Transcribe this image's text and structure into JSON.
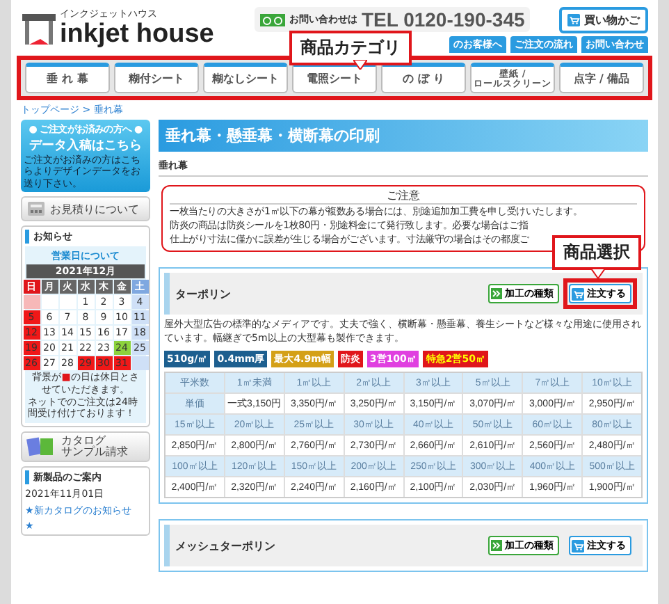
{
  "header": {
    "logo_kana": "インクジェットハウス",
    "logo_text": "inkjet house",
    "contact_label": "お問い合わせは",
    "phone": "TEL 0120-190-345",
    "cart_button": "買い物かご",
    "links": [
      "のお客様へ",
      "ご注文の流れ",
      "お問い合わせ"
    ]
  },
  "nav": {
    "items": [
      "垂 れ 幕",
      "糊付シート",
      "糊なしシート",
      "電照シート",
      "の ぼ り",
      "壁紙 /\nロールスクリーン",
      "点字 / 備品"
    ]
  },
  "annotations": {
    "category": "商品カテゴリ",
    "product_select": "商品選択"
  },
  "breadcrumb": "トップページ > 垂れ幕",
  "sidebar": {
    "data_banner": {
      "top": "● ご注文がお済みの方へ ●",
      "title": "データ入稿はこちら",
      "text": "ご注文がお済みの方はこちらよりデザインデータをお送り下さい。"
    },
    "estimate": "お見積りについて",
    "news": {
      "title": "お知らせ",
      "calendar": {
        "heading": "営業日について",
        "month": "2021年12月",
        "weekdays": [
          {
            "label": "日",
            "kind": "sun"
          },
          {
            "label": "月",
            "kind": "day"
          },
          {
            "label": "火",
            "kind": "day"
          },
          {
            "label": "水",
            "kind": "day"
          },
          {
            "label": "木",
            "kind": "day"
          },
          {
            "label": "金",
            "kind": "day"
          },
          {
            "label": "土",
            "kind": "sat"
          }
        ],
        "weeks": [
          [
            {
              "kind": "past"
            },
            {
              "kind": "normal"
            },
            {
              "kind": "normal"
            },
            {
              "day": "1",
              "kind": "normal"
            },
            {
              "day": "2",
              "kind": "normal"
            },
            {
              "day": "3",
              "kind": "normal"
            },
            {
              "day": "4",
              "kind": "sat"
            }
          ],
          [
            {
              "day": "5",
              "kind": "holiday"
            },
            {
              "day": "6",
              "kind": "normal"
            },
            {
              "day": "7",
              "kind": "normal"
            },
            {
              "day": "8",
              "kind": "normal"
            },
            {
              "day": "9",
              "kind": "normal"
            },
            {
              "day": "10",
              "kind": "normal"
            },
            {
              "day": "11",
              "kind": "sat"
            }
          ],
          [
            {
              "day": "12",
              "kind": "holiday"
            },
            {
              "day": "13",
              "kind": "normal"
            },
            {
              "day": "14",
              "kind": "normal"
            },
            {
              "day": "15",
              "kind": "normal"
            },
            {
              "day": "16",
              "kind": "normal"
            },
            {
              "day": "17",
              "kind": "normal"
            },
            {
              "day": "18",
              "kind": "sat"
            }
          ],
          [
            {
              "day": "19",
              "kind": "holiday"
            },
            {
              "day": "20",
              "kind": "normal"
            },
            {
              "day": "21",
              "kind": "normal"
            },
            {
              "day": "22",
              "kind": "normal"
            },
            {
              "day": "23",
              "kind": "normal"
            },
            {
              "day": "24",
              "kind": "today"
            },
            {
              "day": "25",
              "kind": "sat"
            }
          ],
          [
            {
              "day": "26",
              "kind": "holiday"
            },
            {
              "day": "27",
              "kind": "normal"
            },
            {
              "day": "28",
              "kind": "normal"
            },
            {
              "day": "29",
              "kind": "holiday"
            },
            {
              "day": "30",
              "kind": "holiday"
            },
            {
              "day": "31",
              "kind": "holiday"
            },
            {
              "kind": "sat"
            }
          ]
        ],
        "legend": {
          "before": "背景が",
          "mark": "■",
          "after": "の日は休日とさせていただきます。"
        },
        "note": "ネットでのご注文は24時間受け付けております！"
      }
    },
    "catalog": [
      "カタログ",
      "サンプル請求"
    ],
    "new_products": {
      "title": "新製品のご案内",
      "date": "2021年11月01日",
      "items": [
        "★新カタログのお知らせ",
        "★"
      ]
    }
  },
  "main": {
    "title": "垂れ幕・懸垂幕・横断幕の印刷",
    "section_label": "垂れ幕",
    "notice": {
      "title": "ご注意",
      "lines": [
        "一枚当たりの大きさが1㎡以下の幕が複数ある場合には、別途追加加工費を申し受けいたします。",
        "防炎の商品は防炎シールを1枚80円・別途料金にて発行致します。必要な場合はご指",
        "仕上がり寸法に僅かに誤差が生じる場合がございます。寸法厳守の場合はその都度ご"
      ]
    },
    "products": [
      {
        "name": "ターポリン",
        "process_button": "加工の種類",
        "order_button": "注文する",
        "highlighted": true,
        "description": "屋外大型広告の標準的なメディアです。丈夫で強く、横断幕・懸垂幕、養生シートなど様々な用途に使用されています。幅継ぎで5m以上の大型幕も製作できます。",
        "tags": [
          {
            "text": "510g/㎡",
            "color": "#1d5f8f"
          },
          {
            "text": "0.4mm厚",
            "color": "#1d5f8f"
          },
          {
            "text": "最大4.9m幅",
            "color": "#d4a017"
          },
          {
            "text": "防炎",
            "color": "#e0161b"
          },
          {
            "text": "3営100㎡",
            "color": "#e040e0"
          },
          {
            "text": "特急2営50㎡",
            "color": "#e0161b"
          }
        ],
        "price_rows": [
          {
            "kind": "head",
            "cells": [
              "平米数",
              "1㎡未満",
              "1㎡以上",
              "2㎡以上",
              "3㎡以上",
              "5㎡以上",
              "7㎡以上",
              "10㎡以上"
            ]
          },
          {
            "kind": "price",
            "cells": [
              "単価",
              "一式3,150円",
              "3,350円/㎡",
              "3,250円/㎡",
              "3,150円/㎡",
              "3,070円/㎡",
              "3,000円/㎡",
              "2,950円/㎡"
            ]
          },
          {
            "kind": "head",
            "cells": [
              "15㎡以上",
              "20㎡以上",
              "25㎡以上",
              "30㎡以上",
              "40㎡以上",
              "50㎡以上",
              "60㎡以上",
              "80㎡以上"
            ]
          },
          {
            "kind": "price",
            "cells": [
              "2,850円/㎡",
              "2,800円/㎡",
              "2,760円/㎡",
              "2,730円/㎡",
              "2,660円/㎡",
              "2,610円/㎡",
              "2,560円/㎡",
              "2,480円/㎡"
            ]
          },
          {
            "kind": "head",
            "cells": [
              "100㎡以上",
              "120㎡以上",
              "150㎡以上",
              "200㎡以上",
              "250㎡以上",
              "300㎡以上",
              "400㎡以上",
              "500㎡以上"
            ]
          },
          {
            "kind": "price",
            "cells": [
              "2,400円/㎡",
              "2,320円/㎡",
              "2,240円/㎡",
              "2,160円/㎡",
              "2,100円/㎡",
              "2,030円/㎡",
              "1,960円/㎡",
              "1,900円/㎡"
            ]
          }
        ]
      },
      {
        "name": "メッシュターポリン",
        "process_button": "加工の種類",
        "order_button": "注文する",
        "highlighted": false
      }
    ]
  }
}
